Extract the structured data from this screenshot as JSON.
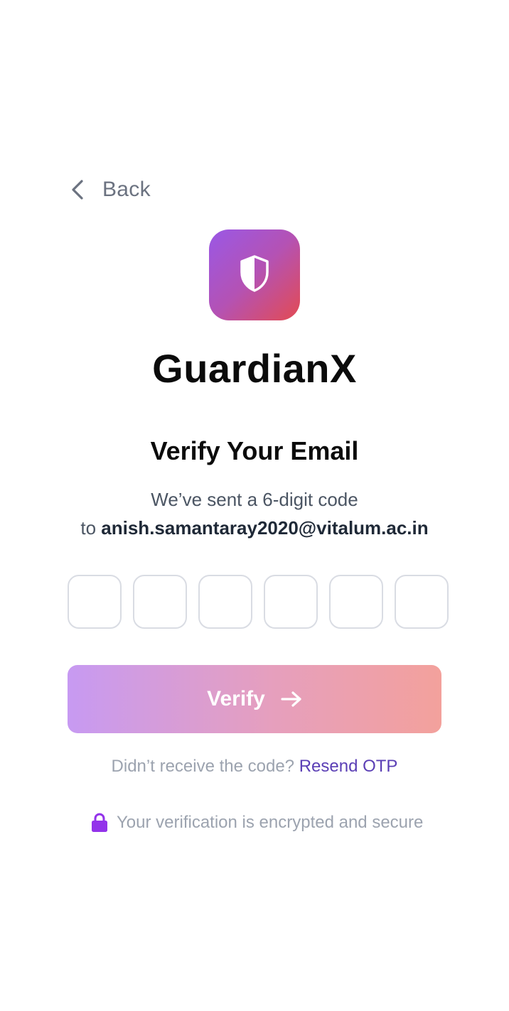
{
  "header": {
    "back_label": "Back"
  },
  "brand": {
    "app_name": "GuardianX",
    "gradient": [
      "#9a58e6",
      "#b452b4",
      "#e34b52"
    ],
    "icon": "shield-icon"
  },
  "verify": {
    "title": "Verify Your Email",
    "subtitle_line1": "We’ve sent a 6-digit code",
    "subtitle_prefix": "to",
    "email": "anish.samantaray2020@vitalum.ac.in",
    "otp_digits": [
      "",
      "",
      "",
      "",
      "",
      ""
    ],
    "button_label": "Verify",
    "button_icon": "arrow-right-icon",
    "button_gradient": [
      "#c79af2",
      "#e69fbd",
      "#f3a19c"
    ]
  },
  "resend": {
    "prompt": "Didn’t receive the code?",
    "link_label": "Resend OTP",
    "link_color": "#5b3fb5"
  },
  "security": {
    "icon": "lock-icon",
    "icon_color": "#9333ea",
    "note": "Your verification is encrypted and secure"
  }
}
